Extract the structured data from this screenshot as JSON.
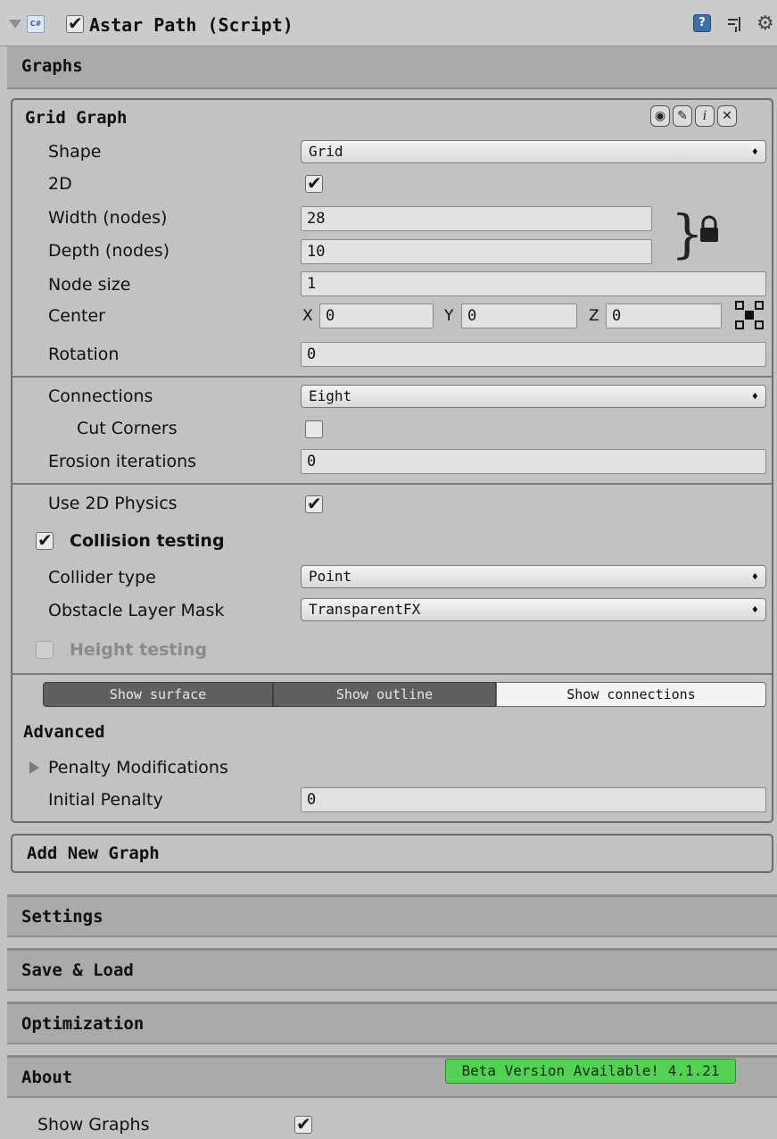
{
  "component": {
    "title": "Astar Path (Script)",
    "script_badge": "C#",
    "enabled": true
  },
  "sections": {
    "graphs": "Graphs",
    "settings": "Settings",
    "save_load": "Save & Load",
    "optimization": "Optimization",
    "about": "About"
  },
  "grid_graph": {
    "title": "Grid Graph",
    "shape_label": "Shape",
    "shape_value": "Grid",
    "two_d_label": "2D",
    "two_d": true,
    "width_label": "Width (nodes)",
    "width_value": "28",
    "depth_label": "Depth (nodes)",
    "depth_value": "10",
    "node_size_label": "Node size",
    "node_size_value": "1",
    "center_label": "Center",
    "center_x_label": "X",
    "center_x": "0",
    "center_y_label": "Y",
    "center_y": "0",
    "center_z_label": "Z",
    "center_z": "0",
    "rotation_label": "Rotation",
    "rotation_value": "0",
    "connections_label": "Connections",
    "connections_value": "Eight",
    "cut_corners_label": "Cut Corners",
    "cut_corners": false,
    "erosion_label": "Erosion iterations",
    "erosion_value": "0",
    "use_2d_physics_label": "Use 2D Physics",
    "use_2d_physics": true,
    "collision_testing_label": "Collision testing",
    "collision_testing": true,
    "collider_type_label": "Collider type",
    "collider_type_value": "Point",
    "obstacle_mask_label": "Obstacle Layer Mask",
    "obstacle_mask_value": "TransparentFX",
    "height_testing_label": "Height testing",
    "height_testing": false,
    "show_surface": "Show surface",
    "show_outline": "Show outline",
    "show_connections": "Show connections",
    "advanced_label": "Advanced",
    "penalty_mod_label": "Penalty Modifications",
    "initial_penalty_label": "Initial Penalty",
    "initial_penalty_value": "0"
  },
  "add_graph": "Add New Graph",
  "about": {
    "beta_badge": "Beta Version Available! 4.1.21"
  },
  "show_graphs_label": "Show Graphs",
  "show_graphs": true,
  "colors": {
    "background": "#c2c2c2",
    "section_bar": "#aaaaaa",
    "beta_green": "#52d152",
    "toggle_dark": "#5a5a5a"
  }
}
